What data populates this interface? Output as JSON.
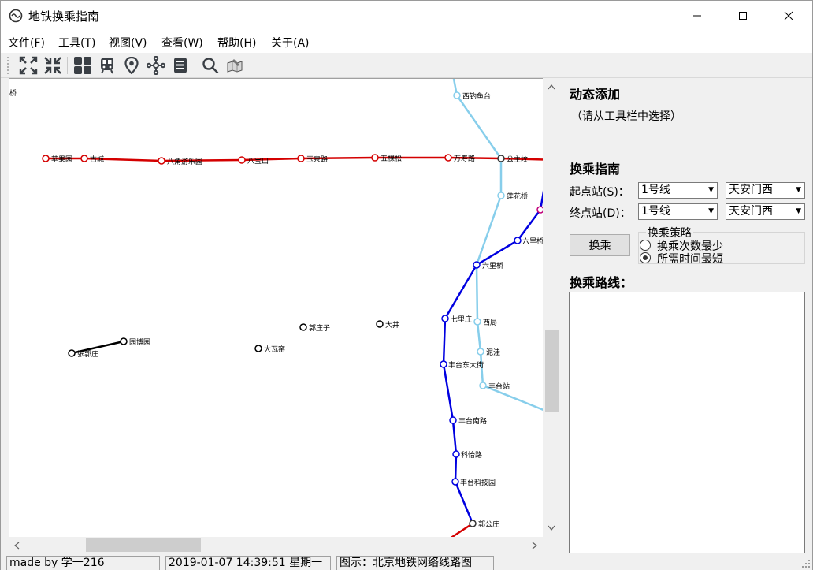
{
  "window": {
    "title": "地铁换乘指南",
    "controls": {
      "minimize": "—",
      "maximize": "☐",
      "close": "✕"
    }
  },
  "menu": {
    "items": [
      "文件(F)",
      "工具(T)",
      "视图(V)",
      "查看(W)",
      "帮助(H)",
      "关于(A)"
    ]
  },
  "toolbar": {
    "buttons": [
      "zoom-in-icon",
      "zoom-out-icon",
      "layout-grid-icon",
      "train-icon",
      "map-pin-icon",
      "network-icon",
      "document-icon",
      "search-icon",
      "map-edit-icon"
    ]
  },
  "map": {
    "colors": {
      "line1": "#d40000",
      "line10": "#0000e0",
      "line9": "#87ceeb",
      "fangshan": "#000000"
    },
    "stations": [
      {
        "name": "桥"
      },
      {
        "name": "西钓鱼台"
      },
      {
        "name": "苹果园"
      },
      {
        "name": "古城"
      },
      {
        "name": "八角游乐园"
      },
      {
        "name": "八宝山"
      },
      {
        "name": "玉泉路"
      },
      {
        "name": "五棵松"
      },
      {
        "name": "万寿路"
      },
      {
        "name": "公主坟"
      },
      {
        "name": "莲花桥"
      },
      {
        "name": "六里桥"
      },
      {
        "name": "六里桥"
      },
      {
        "name": "七里庄"
      },
      {
        "name": "西局"
      },
      {
        "name": "泥洼"
      },
      {
        "name": "丰台东大街"
      },
      {
        "name": "丰台站"
      },
      {
        "name": "丰台南路"
      },
      {
        "name": "科怡路"
      },
      {
        "name": "丰台科技园"
      },
      {
        "name": "郭公庄"
      },
      {
        "name": "郭庄子"
      },
      {
        "name": "大井"
      },
      {
        "name": "大瓦窑"
      },
      {
        "name": "园博园"
      },
      {
        "name": "张郭庄"
      }
    ]
  },
  "panel": {
    "dynamic_title": "动态添加",
    "dynamic_hint": "（请从工具栏中选择）",
    "guide_title": "换乘指南",
    "start_label": "起点站(S)：",
    "end_label": "终点站(D)：",
    "start_line": "1号线",
    "start_station": "天安门西",
    "end_line": "1号线",
    "end_station": "天安门西",
    "transfer_button": "换乘",
    "strategy_title": "换乘策略",
    "strategy_options": [
      {
        "label": "换乘次数最少",
        "checked": false
      },
      {
        "label": "所需时间最短",
        "checked": true
      }
    ],
    "route_title": "换乘路线："
  },
  "status": {
    "author": "made by 学一216",
    "datetime": "2019-01-07 14:39:51 星期一",
    "legend": "图示：北京地铁网络线路图"
  }
}
